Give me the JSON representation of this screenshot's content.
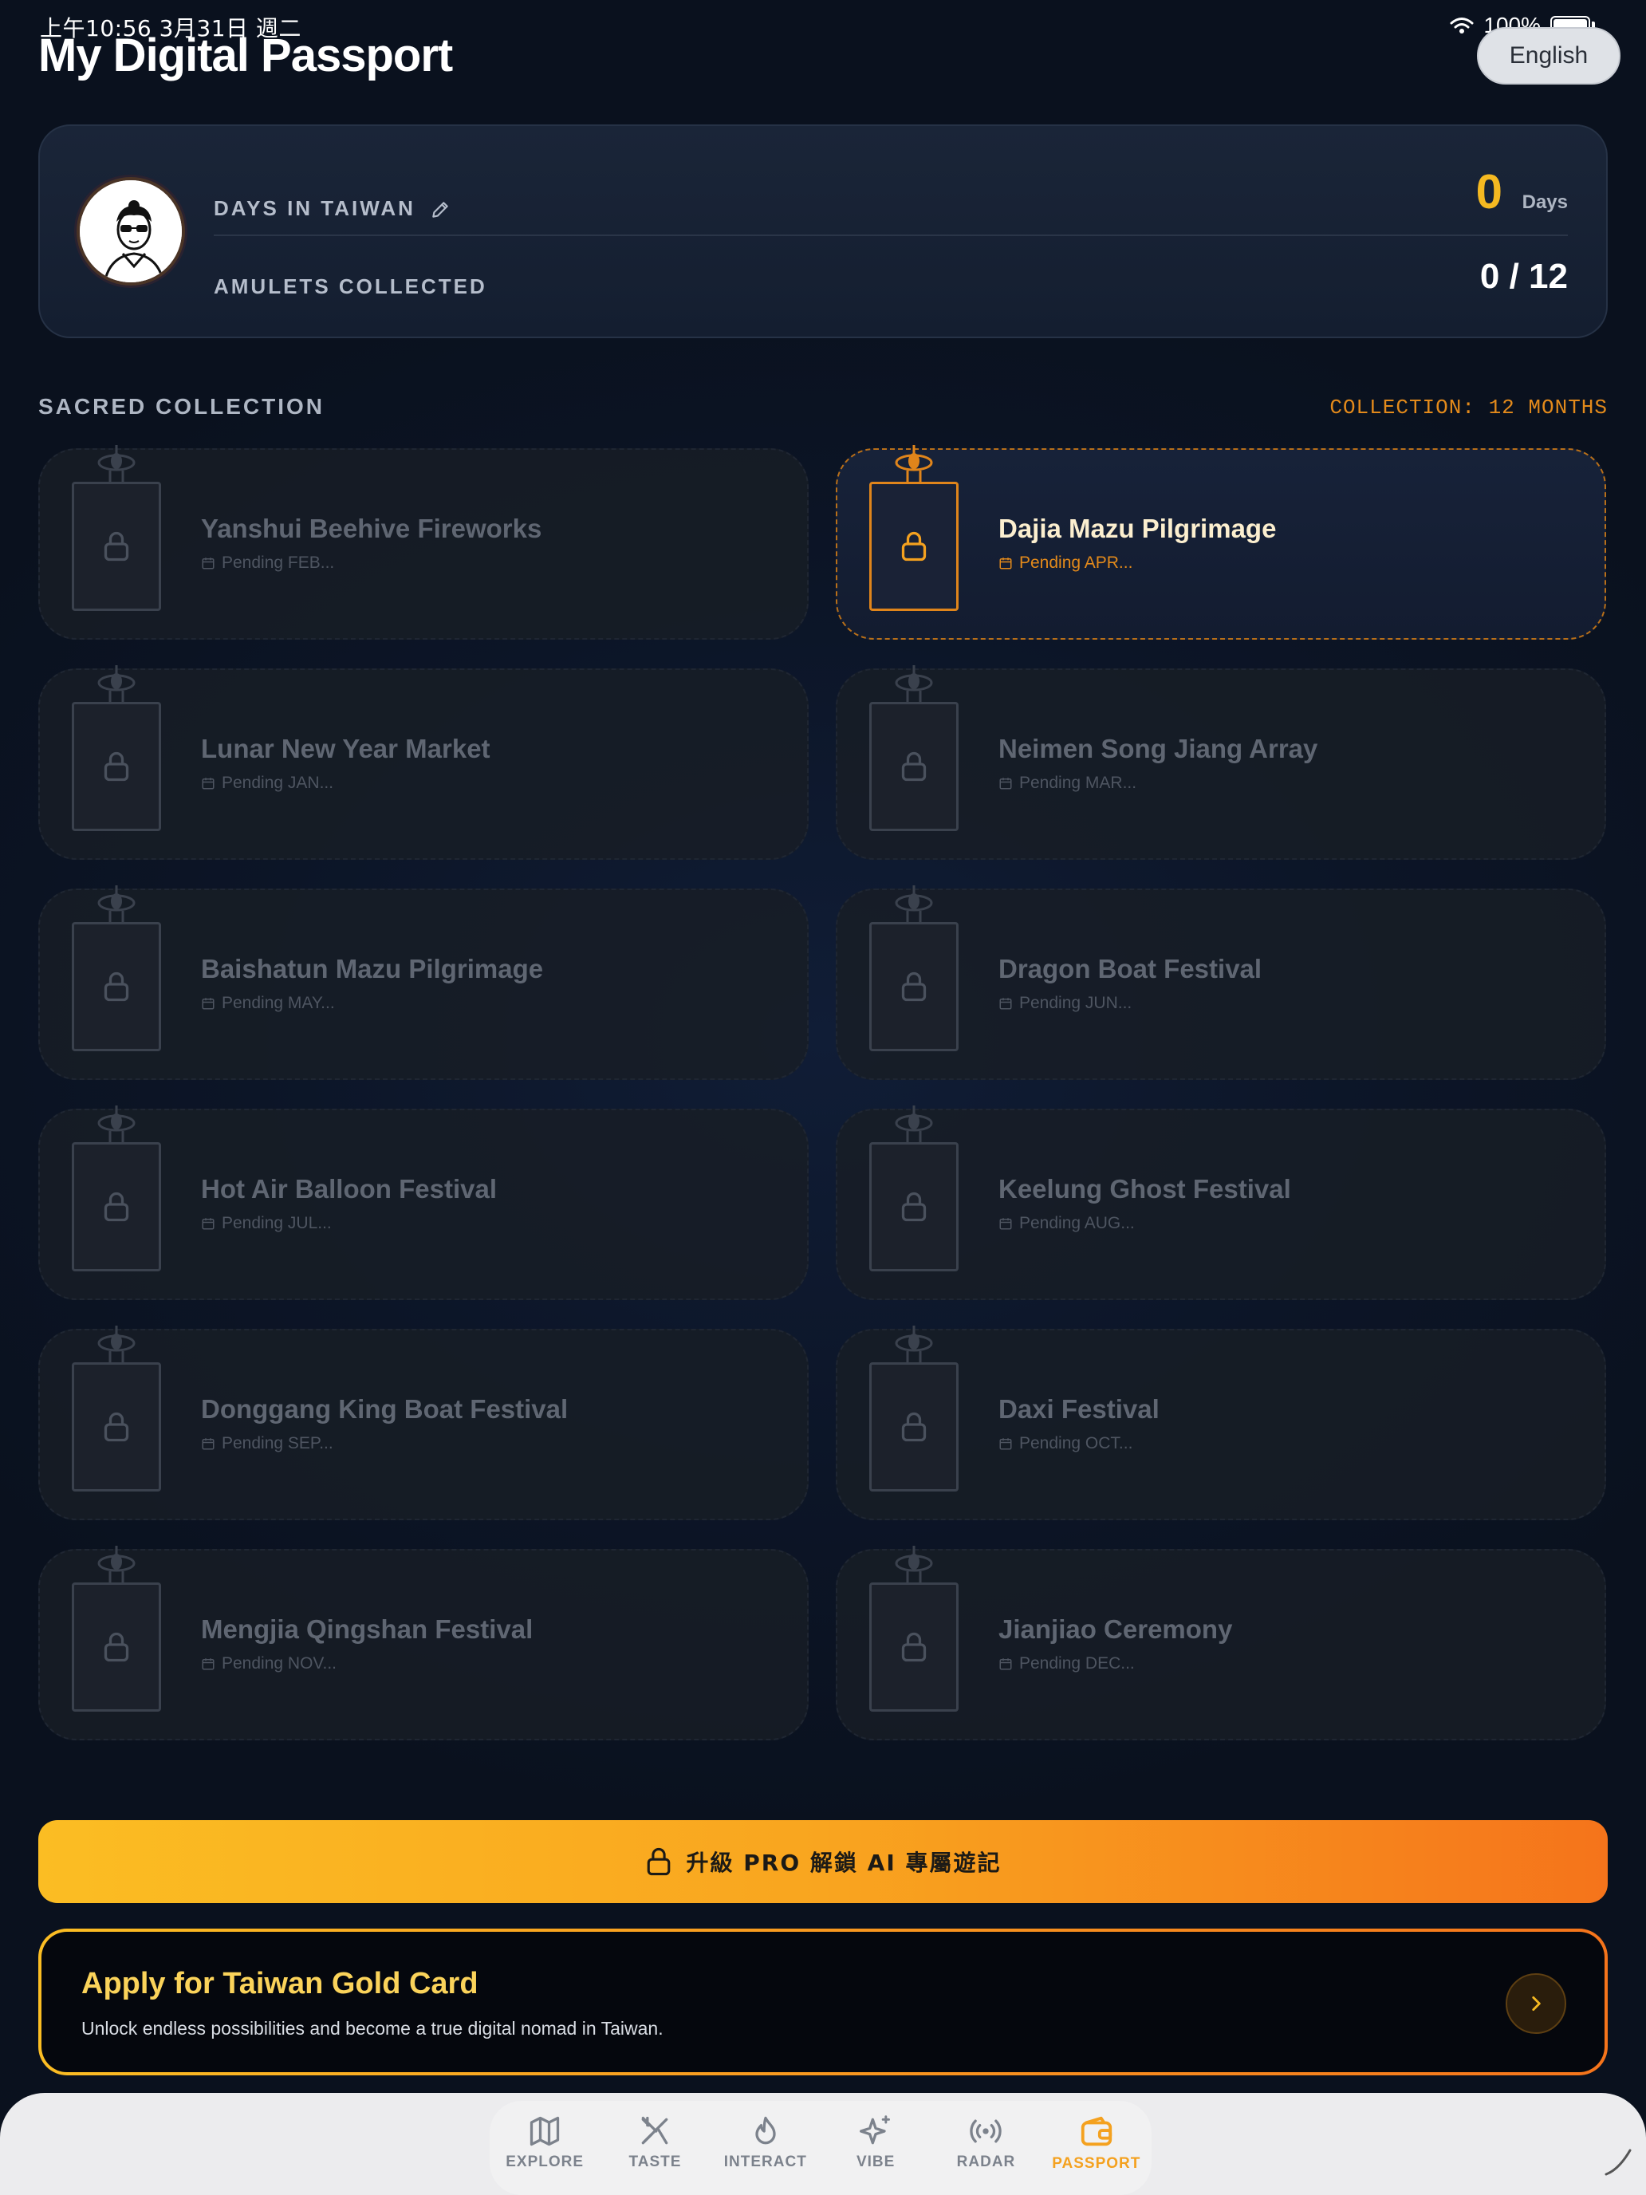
{
  "status_bar": {
    "time": "上午10:56  3月31日 週二",
    "battery": "100%"
  },
  "header": {
    "title": "My Digital Passport",
    "language_button": "English"
  },
  "profile": {
    "days_label": "DAYS IN TAIWAN",
    "days_value": "0",
    "days_unit": "Days",
    "amulets_label": "AMULETS COLLECTED",
    "amulets_value": "0 / 12"
  },
  "collection": {
    "title": "SACRED COLLECTION",
    "meta": "COLLECTION: 12 MONTHS",
    "items": [
      {
        "name": "Yanshui Beehive Fireworks",
        "status": "Pending FEB..."
      },
      {
        "name": "Dajia Mazu Pilgrimage",
        "status": "Pending APR..."
      },
      {
        "name": "Lunar New Year Market",
        "status": "Pending JAN..."
      },
      {
        "name": "Neimen Song Jiang Array",
        "status": "Pending MAR..."
      },
      {
        "name": "Baishatun Mazu Pilgrimage",
        "status": "Pending MAY..."
      },
      {
        "name": "Dragon Boat Festival",
        "status": "Pending JUN..."
      },
      {
        "name": "Hot Air Balloon Festival",
        "status": "Pending JUL..."
      },
      {
        "name": "Keelung Ghost Festival",
        "status": "Pending AUG..."
      },
      {
        "name": "Donggang King Boat Festival",
        "status": "Pending SEP..."
      },
      {
        "name": "Daxi Festival",
        "status": "Pending OCT..."
      },
      {
        "name": "Mengjia Qingshan Festival",
        "status": "Pending NOV..."
      },
      {
        "name": "Jianjiao Ceremony",
        "status": "Pending DEC..."
      }
    ]
  },
  "upgrade_button": "升級 PRO 解鎖 AI 專屬遊記",
  "gold_card": {
    "title": "Apply for Taiwan Gold Card",
    "subtitle": "Unlock endless possibilities and become a true digital nomad in Taiwan."
  },
  "tabs": [
    {
      "label": "EXPLORE",
      "icon": "map-icon"
    },
    {
      "label": "TASTE",
      "icon": "utensils-icon"
    },
    {
      "label": "INTERACT",
      "icon": "flame-icon"
    },
    {
      "label": "VIBE",
      "icon": "sparkles-icon"
    },
    {
      "label": "RADAR",
      "icon": "radar-icon"
    },
    {
      "label": "PASSPORT",
      "icon": "wallet-icon",
      "active": true
    }
  ],
  "colors": {
    "accent": "#f5b921",
    "accent_orange": "#e38a1b",
    "background": "#0b1220"
  }
}
